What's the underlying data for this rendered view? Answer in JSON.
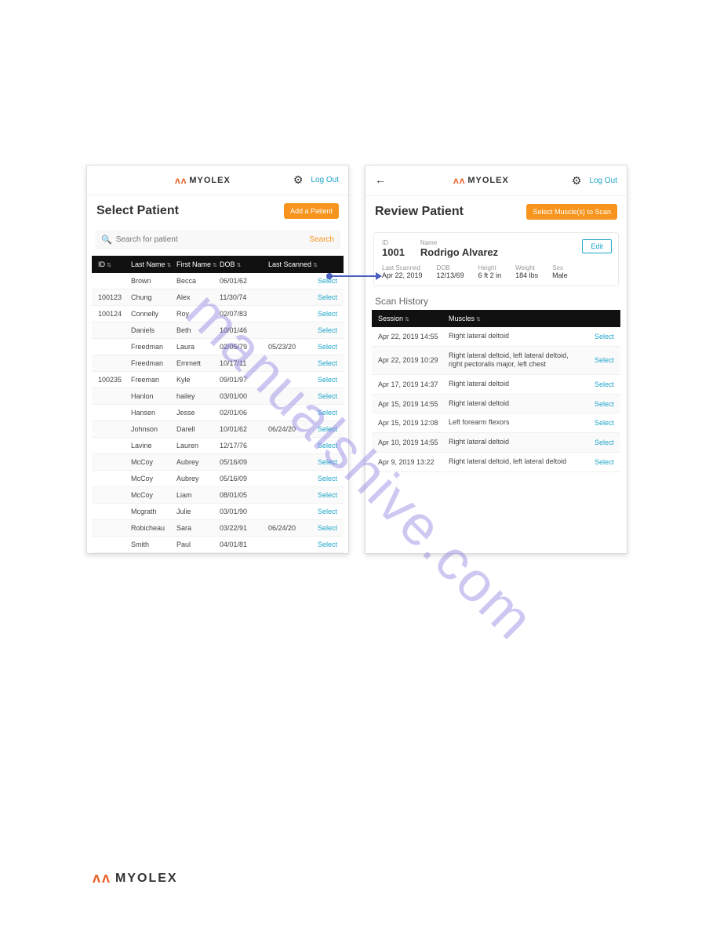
{
  "brand": "MYOLEX",
  "logout": "Log Out",
  "watermark": "manualshive.com",
  "left": {
    "title": "Select Patient",
    "add_btn": "Add a Patient",
    "search_placeholder": "Search for patient",
    "search_btn": "Search",
    "headers": {
      "id": "ID",
      "last": "Last Name",
      "first": "First Name",
      "dob": "DOB",
      "scanned": "Last Scanned"
    },
    "select": "Select",
    "rows": [
      {
        "id": "",
        "last": "Brown",
        "first": "Becca",
        "dob": "06/01/62",
        "scanned": ""
      },
      {
        "id": "100123",
        "last": "Chung",
        "first": "Alex",
        "dob": "11/30/74",
        "scanned": ""
      },
      {
        "id": "100124",
        "last": "Connelly",
        "first": "Roy",
        "dob": "02/07/83",
        "scanned": ""
      },
      {
        "id": "",
        "last": "Daniels",
        "first": "Beth",
        "dob": "10/01/46",
        "scanned": ""
      },
      {
        "id": "",
        "last": "Freedman",
        "first": "Laura",
        "dob": "02/05/79",
        "scanned": "05/23/20"
      },
      {
        "id": "",
        "last": "Freedman",
        "first": "Emmett",
        "dob": "10/17/11",
        "scanned": ""
      },
      {
        "id": "100235",
        "last": "Freeman",
        "first": "Kyle",
        "dob": "09/01/97",
        "scanned": ""
      },
      {
        "id": "",
        "last": "Hanlon",
        "first": "hailey",
        "dob": "03/01/00",
        "scanned": ""
      },
      {
        "id": "",
        "last": "Hansen",
        "first": "Jesse",
        "dob": "02/01/06",
        "scanned": ""
      },
      {
        "id": "",
        "last": "Johnson",
        "first": "Darell",
        "dob": "10/01/62",
        "scanned": "06/24/20"
      },
      {
        "id": "",
        "last": "Lavine",
        "first": "Lauren",
        "dob": "12/17/76",
        "scanned": ""
      },
      {
        "id": "",
        "last": "McCoy",
        "first": "Aubrey",
        "dob": "05/16/09",
        "scanned": ""
      },
      {
        "id": "",
        "last": "McCoy",
        "first": "Aubrey",
        "dob": "05/16/09",
        "scanned": ""
      },
      {
        "id": "",
        "last": "McCoy",
        "first": "Liam",
        "dob": "08/01/05",
        "scanned": ""
      },
      {
        "id": "",
        "last": "Mcgrath",
        "first": "Julie",
        "dob": "03/01/90",
        "scanned": ""
      },
      {
        "id": "",
        "last": "Robicheau",
        "first": "Sara",
        "dob": "03/22/91",
        "scanned": "06/24/20"
      },
      {
        "id": "",
        "last": "Smith",
        "first": "Paul",
        "dob": "04/01/81",
        "scanned": ""
      }
    ]
  },
  "right": {
    "title": "Review Patient",
    "scan_btn": "Select Muscle(s) to Scan",
    "edit": "Edit",
    "labels": {
      "id": "ID",
      "name": "Name",
      "last_scanned": "Last Scanned",
      "dob": "DOB",
      "height": "Height",
      "weight": "Weight",
      "sex": "Sex"
    },
    "patient": {
      "id": "1001",
      "name": "Rodrigo Alvarez",
      "last_scanned": "Apr 22, 2019",
      "dob": "12/13/69",
      "height": "6 ft 2 in",
      "weight": "184 lbs",
      "sex": "Male"
    },
    "history_title": "Scan History",
    "hist_headers": {
      "session": "Session",
      "muscles": "Muscles"
    },
    "select": "Select",
    "history": [
      {
        "session": "Apr 22, 2019 14:55",
        "muscles": "Right lateral deltoid"
      },
      {
        "session": "Apr 22, 2019 10:29",
        "muscles": "Right lateral deltoid, left lateral deltoid, right pectoralis major, left chest"
      },
      {
        "session": "Apr 17, 2019 14:37",
        "muscles": "Right lateral deltoid"
      },
      {
        "session": "Apr 15, 2019 14:55",
        "muscles": "Right lateral deltoid"
      },
      {
        "session": "Apr 15, 2019 12:08",
        "muscles": "Left forearm flexors"
      },
      {
        "session": "Apr 10, 2019 14:55",
        "muscles": "Right lateral deltoid"
      },
      {
        "session": "Apr 9, 2019 13:22",
        "muscles": "Right lateral deltoid, left lateral deltoid"
      }
    ]
  }
}
